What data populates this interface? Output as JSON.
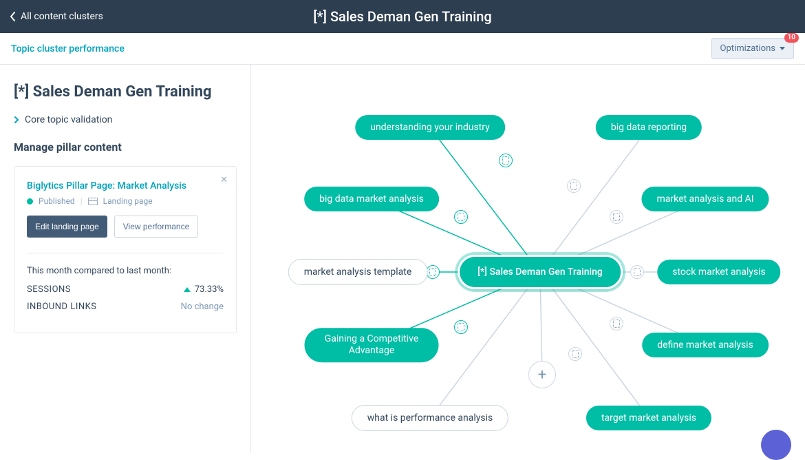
{
  "topbar": {
    "back_label": "All content clusters",
    "title": "[*] Sales Deman Gen Training"
  },
  "subbar": {
    "link": "Topic cluster performance",
    "optimizations_label": "Optimizations",
    "optimizations_count": "10"
  },
  "side": {
    "title": "[*] Sales Deman Gen Training",
    "collapse_label": "Core topic validation",
    "manage_label": "Manage pillar content",
    "card": {
      "title": "Biglytics Pillar Page: Market Analysis",
      "status": "Published",
      "type": "Landing page",
      "edit_btn": "Edit landing page",
      "view_btn": "View performance",
      "compare_label": "This month compared to last month:",
      "stat1_name": "SESSIONS",
      "stat1_val": "73.33%",
      "stat2_name": "INBOUND LINKS",
      "stat2_val": "No change"
    }
  },
  "graph": {
    "center": "[*] Sales Deman Gen Training",
    "nodes": {
      "n0": "understanding your industry",
      "n1": "big data reporting",
      "n2": "big data market analysis",
      "n3": "market analysis and AI",
      "n4": "market analysis template",
      "n5": "stock market analysis",
      "n6_l1": "Gaining a Competitive",
      "n6_l2": "Advantage",
      "n7": "define market analysis",
      "n8": "what is performance analysis",
      "n9": "target market analysis"
    }
  }
}
